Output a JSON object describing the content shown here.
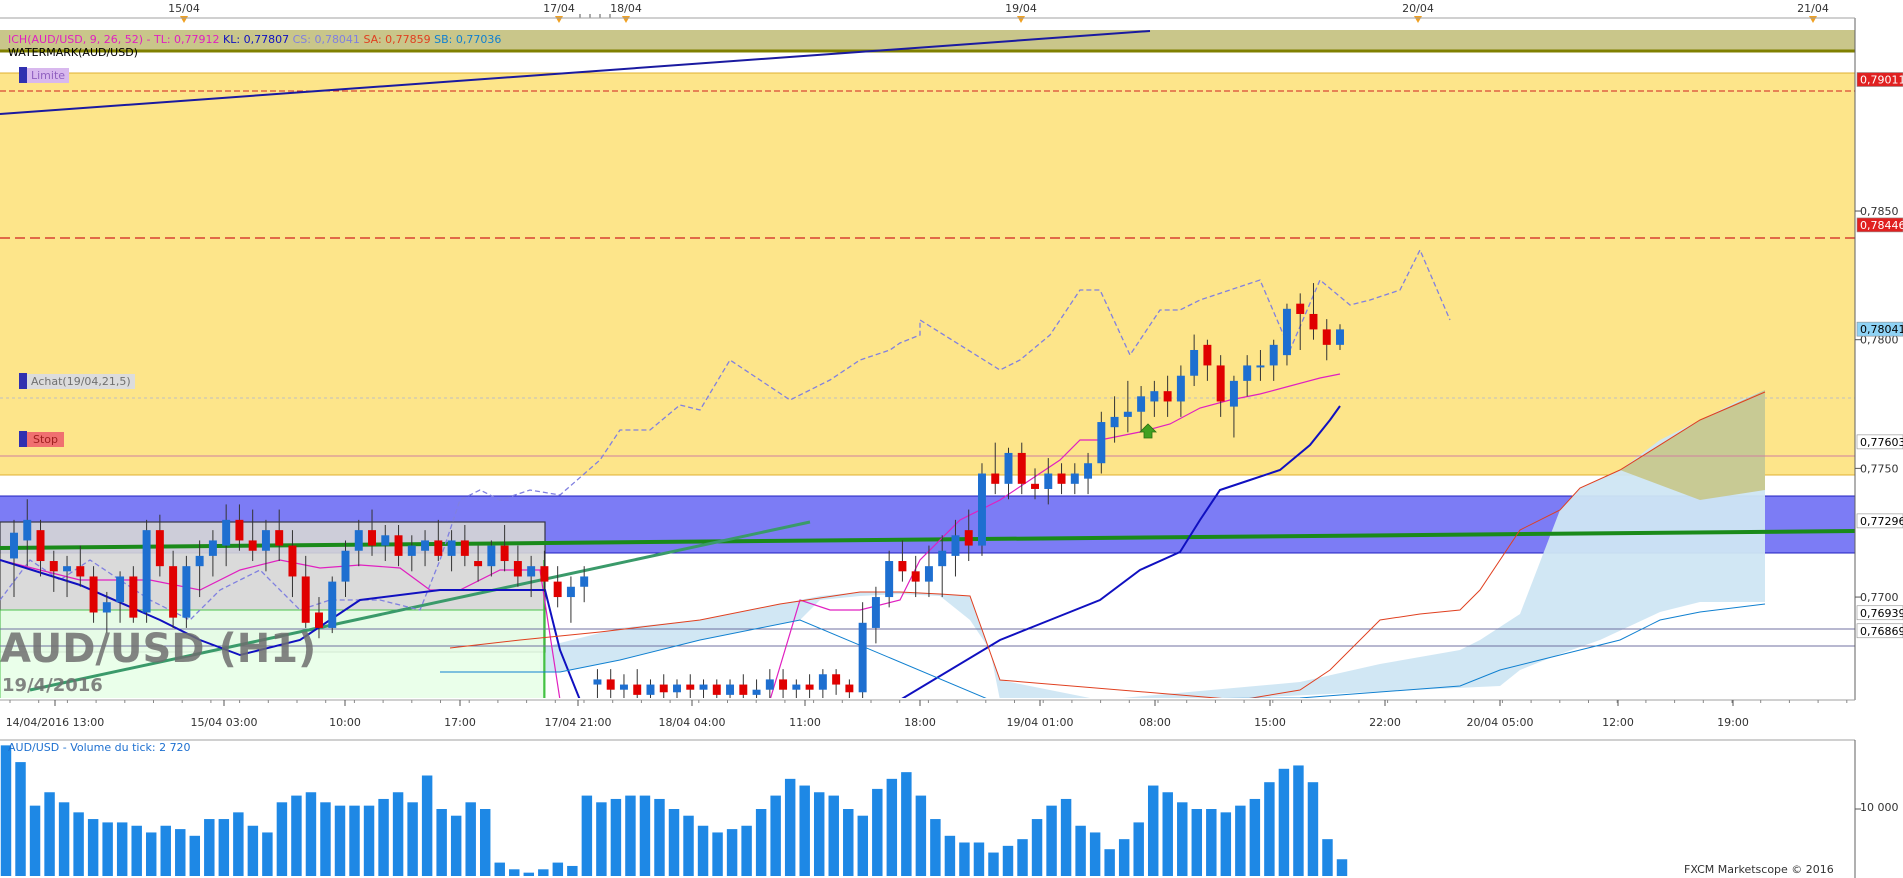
{
  "header": {
    "ich_label": "ICH(AUD/USD, 9, 26, 52) -",
    "tl_label": "TL: 0,77912",
    "kl_label": "KL: 0,77807",
    "cs_label": "CS: 0,78041",
    "sa_label": "SA: 0,77859",
    "sb_label": "SB: 0,77036",
    "watermark_label": "WATERMARK(AUD/USD)"
  },
  "order_tags": {
    "limit": "Limite",
    "buy": "Achat(19/04,21,5)",
    "stop": "Stop"
  },
  "watermark": {
    "title": "AUD/USD (H1)",
    "date": "19/4/2016"
  },
  "top_dates": [
    "15/04",
    "17/04",
    "18/04",
    "19/04",
    "20/04",
    "21/04"
  ],
  "price_axis": {
    "ticks": [
      "0,7850",
      "0,7800",
      "0,7750",
      "0,7700"
    ],
    "badges": [
      {
        "value": "0,79011",
        "color": "#e02020",
        "text_color": "#ffffff"
      },
      {
        "value": "0,78446",
        "color": "#e02020",
        "text_color": "#ffffff"
      },
      {
        "value": "0,78041",
        "color": "#8fd3f5",
        "text_color": "#000000"
      },
      {
        "value": "0,77603",
        "color": "#ffffff",
        "text_color": "#000000"
      },
      {
        "value": "0,77296",
        "color": "#ffffff",
        "text_color": "#000000"
      },
      {
        "value": "0,76939",
        "color": "#ffffff",
        "text_color": "#000000"
      },
      {
        "value": "0,76869",
        "color": "#ffffff",
        "text_color": "#000000"
      }
    ]
  },
  "time_axis": [
    "14/04/2016 13:00",
    "15/04 03:00",
    "10:00",
    "17:00",
    "17/04 21:00",
    "18/04 04:00",
    "11:00",
    "18:00",
    "19/04 01:00",
    "08:00",
    "15:00",
    "22:00",
    "20/04 05:00",
    "12:00",
    "19:00"
  ],
  "volume_panel": {
    "title": "AUD/USD - Volume du tick: 2 720",
    "tick": "10 000",
    "credit": "FXCM Marketscope © 2016"
  },
  "colors": {
    "bull": "#1e6fd0",
    "bear": "#e00000",
    "zone_yellow": "#fde58a",
    "zone_blue": "#7c7cf5",
    "kumo": "#cfe6f3",
    "volume": "#1e88e5"
  },
  "chart_data": {
    "type": "candlestick",
    "timeframe": "H1",
    "ylim": [
      0.766,
      0.7925
    ],
    "yticks": [
      0.785,
      0.78,
      0.775,
      0.77
    ],
    "candles": [
      {
        "o": 0.7715,
        "h": 0.773,
        "l": 0.77,
        "c": 0.7725
      },
      {
        "o": 0.7722,
        "h": 0.7738,
        "l": 0.7712,
        "c": 0.773
      },
      {
        "o": 0.7726,
        "h": 0.773,
        "l": 0.7708,
        "c": 0.7714
      },
      {
        "o": 0.7714,
        "h": 0.7718,
        "l": 0.7702,
        "c": 0.771
      },
      {
        "o": 0.771,
        "h": 0.7716,
        "l": 0.77,
        "c": 0.7712
      },
      {
        "o": 0.7712,
        "h": 0.772,
        "l": 0.7704,
        "c": 0.7708
      },
      {
        "o": 0.7708,
        "h": 0.7712,
        "l": 0.769,
        "c": 0.7694
      },
      {
        "o": 0.7694,
        "h": 0.7702,
        "l": 0.7686,
        "c": 0.7698
      },
      {
        "o": 0.7698,
        "h": 0.771,
        "l": 0.769,
        "c": 0.7708
      },
      {
        "o": 0.7708,
        "h": 0.7712,
        "l": 0.769,
        "c": 0.7692
      },
      {
        "o": 0.7694,
        "h": 0.773,
        "l": 0.769,
        "c": 0.7726
      },
      {
        "o": 0.7726,
        "h": 0.7732,
        "l": 0.7708,
        "c": 0.7712
      },
      {
        "o": 0.7712,
        "h": 0.7718,
        "l": 0.7688,
        "c": 0.7692
      },
      {
        "o": 0.7692,
        "h": 0.7716,
        "l": 0.7688,
        "c": 0.7712
      },
      {
        "o": 0.7712,
        "h": 0.7722,
        "l": 0.77,
        "c": 0.7716
      },
      {
        "o": 0.7716,
        "h": 0.7726,
        "l": 0.7708,
        "c": 0.7722
      },
      {
        "o": 0.772,
        "h": 0.7736,
        "l": 0.7712,
        "c": 0.773
      },
      {
        "o": 0.773,
        "h": 0.7736,
        "l": 0.7718,
        "c": 0.7722
      },
      {
        "o": 0.7722,
        "h": 0.7734,
        "l": 0.7714,
        "c": 0.7718
      },
      {
        "o": 0.7718,
        "h": 0.773,
        "l": 0.771,
        "c": 0.7726
      },
      {
        "o": 0.7726,
        "h": 0.7734,
        "l": 0.7714,
        "c": 0.772
      },
      {
        "o": 0.772,
        "h": 0.7726,
        "l": 0.77,
        "c": 0.7708
      },
      {
        "o": 0.7708,
        "h": 0.7716,
        "l": 0.7688,
        "c": 0.769
      },
      {
        "o": 0.7694,
        "h": 0.77,
        "l": 0.7684,
        "c": 0.7688
      },
      {
        "o": 0.7688,
        "h": 0.7708,
        "l": 0.7686,
        "c": 0.7706
      },
      {
        "o": 0.7706,
        "h": 0.7722,
        "l": 0.77,
        "c": 0.7718
      },
      {
        "o": 0.7718,
        "h": 0.773,
        "l": 0.7712,
        "c": 0.7726
      },
      {
        "o": 0.7726,
        "h": 0.7734,
        "l": 0.7716,
        "c": 0.772
      },
      {
        "o": 0.772,
        "h": 0.7728,
        "l": 0.7714,
        "c": 0.7724
      },
      {
        "o": 0.7724,
        "h": 0.7728,
        "l": 0.7712,
        "c": 0.7716
      },
      {
        "o": 0.7716,
        "h": 0.7724,
        "l": 0.771,
        "c": 0.772
      },
      {
        "o": 0.7718,
        "h": 0.7726,
        "l": 0.7712,
        "c": 0.7722
      },
      {
        "o": 0.7722,
        "h": 0.773,
        "l": 0.7714,
        "c": 0.7716
      },
      {
        "o": 0.7716,
        "h": 0.7726,
        "l": 0.771,
        "c": 0.7722
      },
      {
        "o": 0.7722,
        "h": 0.7728,
        "l": 0.7712,
        "c": 0.7716
      },
      {
        "o": 0.7714,
        "h": 0.772,
        "l": 0.7706,
        "c": 0.7712
      },
      {
        "o": 0.7712,
        "h": 0.7722,
        "l": 0.7708,
        "c": 0.772
      },
      {
        "o": 0.772,
        "h": 0.7728,
        "l": 0.771,
        "c": 0.7714
      },
      {
        "o": 0.7714,
        "h": 0.772,
        "l": 0.7704,
        "c": 0.7708
      },
      {
        "o": 0.7708,
        "h": 0.7716,
        "l": 0.77,
        "c": 0.7712
      },
      {
        "o": 0.7712,
        "h": 0.7718,
        "l": 0.7702,
        "c": 0.7706
      },
      {
        "o": 0.7706,
        "h": 0.7712,
        "l": 0.7696,
        "c": 0.77
      },
      {
        "o": 0.77,
        "h": 0.7708,
        "l": 0.769,
        "c": 0.7704
      },
      {
        "o": 0.7704,
        "h": 0.7712,
        "l": 0.7698,
        "c": 0.7708
      },
      {
        "o": 0.7666,
        "h": 0.7672,
        "l": 0.766,
        "c": 0.7668
      },
      {
        "o": 0.7668,
        "h": 0.7672,
        "l": 0.766,
        "c": 0.7664
      },
      {
        "o": 0.7664,
        "h": 0.767,
        "l": 0.7658,
        "c": 0.7666
      },
      {
        "o": 0.7666,
        "h": 0.7672,
        "l": 0.766,
        "c": 0.7662
      },
      {
        "o": 0.7662,
        "h": 0.7668,
        "l": 0.7658,
        "c": 0.7666
      },
      {
        "o": 0.7666,
        "h": 0.767,
        "l": 0.766,
        "c": 0.7663
      },
      {
        "o": 0.7663,
        "h": 0.7668,
        "l": 0.766,
        "c": 0.7666
      },
      {
        "o": 0.7666,
        "h": 0.767,
        "l": 0.766,
        "c": 0.7664
      },
      {
        "o": 0.7664,
        "h": 0.7668,
        "l": 0.766,
        "c": 0.7666
      },
      {
        "o": 0.7666,
        "h": 0.7668,
        "l": 0.766,
        "c": 0.7662
      },
      {
        "o": 0.7662,
        "h": 0.7668,
        "l": 0.7658,
        "c": 0.7666
      },
      {
        "o": 0.7666,
        "h": 0.767,
        "l": 0.766,
        "c": 0.7662
      },
      {
        "o": 0.7662,
        "h": 0.7668,
        "l": 0.7658,
        "c": 0.7664
      },
      {
        "o": 0.7664,
        "h": 0.7672,
        "l": 0.766,
        "c": 0.7668
      },
      {
        "o": 0.7668,
        "h": 0.7672,
        "l": 0.766,
        "c": 0.7664
      },
      {
        "o": 0.7664,
        "h": 0.7668,
        "l": 0.7658,
        "c": 0.7666
      },
      {
        "o": 0.7666,
        "h": 0.767,
        "l": 0.766,
        "c": 0.7664
      },
      {
        "o": 0.7664,
        "h": 0.7672,
        "l": 0.766,
        "c": 0.767
      },
      {
        "o": 0.767,
        "h": 0.7672,
        "l": 0.7662,
        "c": 0.7666
      },
      {
        "o": 0.7666,
        "h": 0.7668,
        "l": 0.766,
        "c": 0.7663
      },
      {
        "o": 0.7663,
        "h": 0.7698,
        "l": 0.766,
        "c": 0.769
      },
      {
        "o": 0.7688,
        "h": 0.7704,
        "l": 0.7682,
        "c": 0.77
      },
      {
        "o": 0.77,
        "h": 0.7718,
        "l": 0.7696,
        "c": 0.7714
      },
      {
        "o": 0.7714,
        "h": 0.7722,
        "l": 0.7706,
        "c": 0.771
      },
      {
        "o": 0.771,
        "h": 0.7716,
        "l": 0.77,
        "c": 0.7706
      },
      {
        "o": 0.7706,
        "h": 0.772,
        "l": 0.77,
        "c": 0.7712
      },
      {
        "o": 0.7712,
        "h": 0.7724,
        "l": 0.77,
        "c": 0.7718
      },
      {
        "o": 0.7716,
        "h": 0.773,
        "l": 0.7708,
        "c": 0.7724
      },
      {
        "o": 0.7726,
        "h": 0.7734,
        "l": 0.7714,
        "c": 0.772
      },
      {
        "o": 0.772,
        "h": 0.7752,
        "l": 0.7716,
        "c": 0.7748
      },
      {
        "o": 0.7748,
        "h": 0.776,
        "l": 0.774,
        "c": 0.7744
      },
      {
        "o": 0.7744,
        "h": 0.7758,
        "l": 0.7738,
        "c": 0.7756
      },
      {
        "o": 0.7756,
        "h": 0.776,
        "l": 0.774,
        "c": 0.7744
      },
      {
        "o": 0.7744,
        "h": 0.775,
        "l": 0.7738,
        "c": 0.7742
      },
      {
        "o": 0.7742,
        "h": 0.7754,
        "l": 0.7736,
        "c": 0.7748
      },
      {
        "o": 0.7748,
        "h": 0.7752,
        "l": 0.774,
        "c": 0.7744
      },
      {
        "o": 0.7744,
        "h": 0.7752,
        "l": 0.774,
        "c": 0.7748
      },
      {
        "o": 0.7746,
        "h": 0.7756,
        "l": 0.774,
        "c": 0.7752
      },
      {
        "o": 0.7752,
        "h": 0.7772,
        "l": 0.7748,
        "c": 0.7768
      },
      {
        "o": 0.7766,
        "h": 0.7778,
        "l": 0.776,
        "c": 0.777
      },
      {
        "o": 0.777,
        "h": 0.7784,
        "l": 0.7764,
        "c": 0.7772
      },
      {
        "o": 0.7772,
        "h": 0.7782,
        "l": 0.7764,
        "c": 0.7778
      },
      {
        "o": 0.7776,
        "h": 0.7784,
        "l": 0.777,
        "c": 0.778
      },
      {
        "o": 0.778,
        "h": 0.7786,
        "l": 0.777,
        "c": 0.7776
      },
      {
        "o": 0.7776,
        "h": 0.779,
        "l": 0.777,
        "c": 0.7786
      },
      {
        "o": 0.7786,
        "h": 0.7802,
        "l": 0.7782,
        "c": 0.7796
      },
      {
        "o": 0.7798,
        "h": 0.78,
        "l": 0.7784,
        "c": 0.779
      },
      {
        "o": 0.779,
        "h": 0.7794,
        "l": 0.777,
        "c": 0.7776
      },
      {
        "o": 0.7774,
        "h": 0.7786,
        "l": 0.7762,
        "c": 0.7784
      },
      {
        "o": 0.7784,
        "h": 0.7794,
        "l": 0.7778,
        "c": 0.779
      },
      {
        "o": 0.779,
        "h": 0.7796,
        "l": 0.7784,
        "c": 0.779
      },
      {
        "o": 0.779,
        "h": 0.78,
        "l": 0.7784,
        "c": 0.7798
      },
      {
        "o": 0.7794,
        "h": 0.7814,
        "l": 0.779,
        "c": 0.7812
      },
      {
        "o": 0.7814,
        "h": 0.7818,
        "l": 0.7796,
        "c": 0.781
      },
      {
        "o": 0.781,
        "h": 0.7822,
        "l": 0.78,
        "c": 0.7804
      },
      {
        "o": 0.7804,
        "h": 0.7808,
        "l": 0.7792,
        "c": 0.7798
      },
      {
        "o": 0.7798,
        "h": 0.7806,
        "l": 0.7796,
        "c": 0.7804
      }
    ],
    "volume": [
      19500,
      17000,
      10500,
      12500,
      11000,
      9500,
      8500,
      8000,
      8000,
      7500,
      6500,
      7500,
      7000,
      6000,
      8500,
      8500,
      9500,
      7500,
      6500,
      11000,
      12000,
      12500,
      11000,
      10500,
      10500,
      10500,
      11500,
      12500,
      11000,
      15000,
      10000,
      9000,
      11000,
      10000,
      2000,
      1000,
      500,
      1000,
      2000,
      1500,
      12000,
      11000,
      11500,
      12000,
      12000,
      11500,
      10000,
      9000,
      7500,
      6500,
      7000,
      7500,
      10000,
      12000,
      14500,
      13500,
      12500,
      12000,
      10000,
      9000,
      13000,
      14500,
      15500,
      12000,
      8500,
      6000,
      5000,
      5000,
      3500,
      4500,
      5500,
      8500,
      10500,
      11500,
      7500,
      6500,
      4000,
      5500,
      8000,
      13500,
      12500,
      11000,
      10000,
      10000,
      9500,
      10500,
      11500,
      14000,
      16000,
      16500,
      14000,
      5500,
      2500
    ],
    "levels": {
      "limite": 0.79011,
      "stop": 0.77603,
      "achat": 0.77803,
      "line_1": 0.78446,
      "line_2": 0.77296,
      "line_3": 0.76939,
      "line_4": 0.76869,
      "current": 0.78041
    }
  }
}
